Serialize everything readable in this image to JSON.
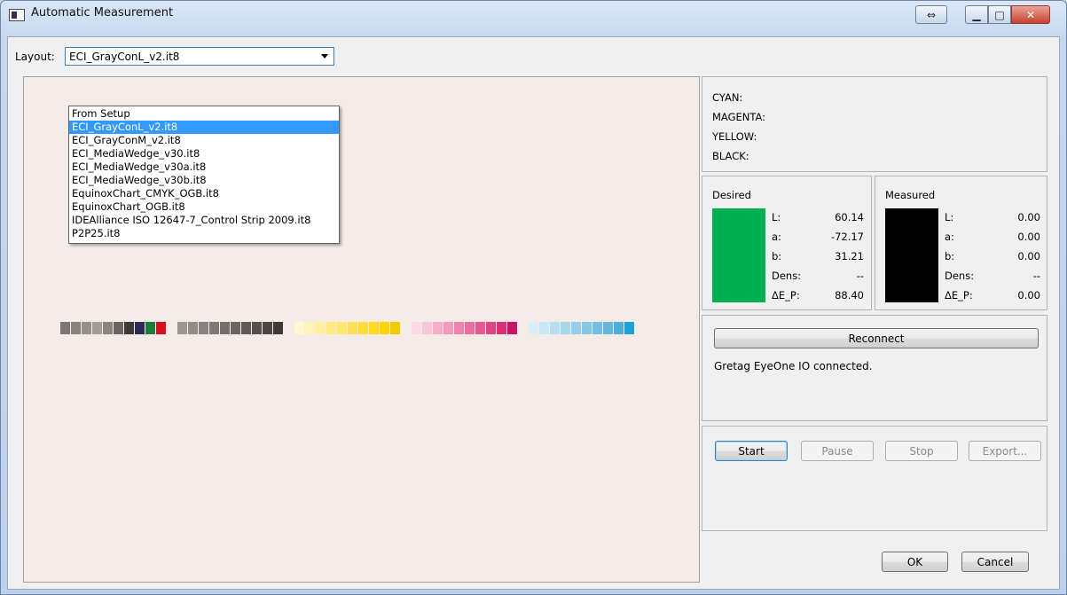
{
  "window": {
    "title": "Automatic Measurement",
    "swap_glyph": "⇔",
    "min_glyph": "▁",
    "max_glyph": "□",
    "close_glyph": "✕"
  },
  "layout": {
    "label": "Layout:",
    "selected": "ECI_GrayConL_v2.it8",
    "options": [
      "From Setup",
      "ECI_GrayConL_v2.it8",
      "ECI_GrayConM_v2.it8",
      "ECI_MediaWedge_v30.it8",
      "ECI_MediaWedge_v30a.it8",
      "ECI_MediaWedge_v30b.it8",
      "EquinoxChart_CMYK_OGB.it8",
      "EquinoxChart_OGB.it8",
      "IDEAlliance ISO 12647-7_Control Strip 2009.it8",
      "P2P25.it8"
    ]
  },
  "inks": [
    "CYAN:",
    "MAGENTA:",
    "YELLOW:",
    "BLACK:"
  ],
  "desired": {
    "title": "Desired",
    "color": "#00b050",
    "rows": [
      {
        "key": "L:",
        "value": "60.14"
      },
      {
        "key": "a:",
        "value": "-72.17"
      },
      {
        "key": "b:",
        "value": "31.21"
      },
      {
        "key": "Dens:",
        "value": "--"
      },
      {
        "key": "ΔE_P:",
        "value": "88.40"
      }
    ]
  },
  "measured": {
    "title": "Measured",
    "color": "#000000",
    "rows": [
      {
        "key": "L:",
        "value": "0.00"
      },
      {
        "key": "a:",
        "value": "0.00"
      },
      {
        "key": "b:",
        "value": "0.00"
      },
      {
        "key": "Dens:",
        "value": "--"
      },
      {
        "key": "ΔE_P:",
        "value": "0.00"
      }
    ]
  },
  "connection": {
    "reconnect_label": "Reconnect",
    "status": "Gretag EyeOne IO connected."
  },
  "controls": {
    "start": "Start",
    "pause": "Pause",
    "stop": "Stop",
    "export": "Export..."
  },
  "dialog": {
    "ok": "OK",
    "cancel": "Cancel"
  },
  "strip_colors": [
    "#7d7774",
    "#898380",
    "#958f8c",
    "#a29c99",
    "#8a8380",
    "#6b6461",
    "#3f3a3a",
    "#2e2a55",
    "#1b7c3c",
    "#d3131c",
    "#f5ece8",
    "#9c9693",
    "#928c89",
    "#888280",
    "#7e7876",
    "#746e6c",
    "#6a6462",
    "#5f5957",
    "#554f4d",
    "#4a4442",
    "#3f3a38",
    "#f5ece8",
    "#fff7cf",
    "#fff3b8",
    "#ffef9f",
    "#ffeb86",
    "#ffe66d",
    "#ffe254",
    "#ffde3b",
    "#ffd921",
    "#ffd508",
    "#f5c800",
    "#f5ece8",
    "#fbdbe8",
    "#f8c5d9",
    "#f4afcb",
    "#f09abc",
    "#ec84ae",
    "#e86fa0",
    "#e45a92",
    "#df4584",
    "#d93076",
    "#c9156a",
    "#f5ece8",
    "#d9eef8",
    "#c9e7f4",
    "#b8dff1",
    "#a7d7ed",
    "#96cfe9",
    "#85c7e5",
    "#74bfe1",
    "#62b7dc",
    "#4faed8",
    "#1ea2d6"
  ]
}
